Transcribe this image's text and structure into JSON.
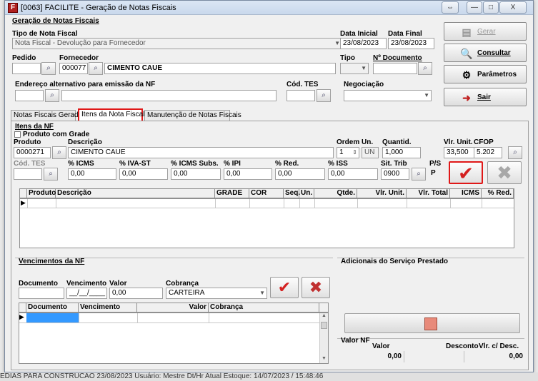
{
  "window": {
    "title": "[0063] FACILITE - Geração de Notas Fiscais",
    "icon_letter": "F",
    "controls": {
      "min": "—",
      "max": "□",
      "close": "X",
      "extra": "⇔"
    }
  },
  "header": {
    "section_title": "Geração de Notas Fiscais",
    "tipo_label": "Tipo de Nota Fiscal",
    "tipo_value": "Nota Fiscal - Devolução para Fornecedor",
    "data_inicial_label": "Data Inicial",
    "data_inicial": "23/08/2023",
    "data_final_label": "Data Final",
    "data_final": "23/08/2023",
    "pedido_label": "Pedido",
    "pedido_value": "",
    "fornecedor_label": "Fornecedor",
    "fornecedor_code": "000077",
    "fornecedor_name": "CIMENTO CAUE",
    "tipo2_label": "Tipo",
    "tipo2_value": "",
    "num_doc_label": "Nº Documento",
    "num_doc_value": "",
    "endereco_label": "Endereço alternativo para emissão da NF",
    "endereco_code": "",
    "endereco_text": "",
    "cod_tes_label": "Cód. TES",
    "cod_tes_value": "",
    "negociacao_label": "Negociação",
    "negociacao_value": ""
  },
  "side_buttons": {
    "gerar": "Gerar",
    "consultar": "Consultar",
    "parametros": "Parâmetros",
    "sair": "Sair"
  },
  "tabs": [
    "Notas Fiscais Geradas",
    "Itens da Nota Fiscal",
    "Manutenção de Notas Fiscais"
  ],
  "itens": {
    "section": "Itens da NF",
    "produto_com_grade": "Produto com Grade",
    "produto_label": "Produto",
    "produto_value": "0000271",
    "descricao_label": "Descrição",
    "descricao_value": "CIMENTO CAUE",
    "ordem_label": "Ordem",
    "ordem_value": "1",
    "un_label": "Un.",
    "un_value": "UN",
    "quantid_label": "Quantid.",
    "quantid_value": "1,000",
    "vlr_unit_label": "Vlr. Unit.",
    "vlr_unit_value": "33,500",
    "cfop_label": "CFOP",
    "cfop_value": "5.202",
    "cod_tes_label": "Cód. TES",
    "cod_tes_value": "",
    "icms_label": "% ICMS",
    "icms_value": "0,00",
    "iva_label": "% IVA-ST",
    "iva_value": "0,00",
    "icms_subs_label": "% ICMS Subs.",
    "icms_subs_value": "0,00",
    "ipi_label": "% IPI",
    "ipi_value": "0,00",
    "red_label": "% Red.",
    "red_value": "0,00",
    "iss_label": "% ISS",
    "iss_value": "0,00",
    "sit_trib_label": "Sit. Trib",
    "sit_trib_value": "0900",
    "ps_label": "P/S",
    "ps_value": "P",
    "grid_headers": [
      "Produto",
      "Descrição",
      "GRADE",
      "COR",
      "Seq.",
      "Un.",
      "Qtde.",
      "Vlr. Unit.",
      "Vlr. Total",
      "ICMS",
      "% Red."
    ]
  },
  "vencimentos": {
    "section": "Vencimentos da NF",
    "documento_label": "Documento",
    "documento_value": "",
    "vencimento_label": "Vencimento",
    "vencimento_value": "__/__/____",
    "valor_label": "Valor",
    "valor_value": "0,00",
    "cobranca_label": "Cobrança",
    "cobranca_value": "CARTEIRA",
    "grid_headers": [
      "Documento",
      "Vencimento",
      "Valor",
      "Cobrança"
    ]
  },
  "adicionais": {
    "section": "Adicionais do Serviço Prestado"
  },
  "totais": {
    "valor_nf_label": "Valor NF",
    "valor_label": "Valor",
    "valor_value": "0,00",
    "desconto_label": "Desconto",
    "desconto_value": "",
    "vlr_desc_label": "Vlr. c/ Desc.",
    "vlr_desc_value": "0,00"
  },
  "status_bar": "EDIAS PARA CONSTRUCAO            23/08/2023   Usuário: Mestre          Dt/Hr Atual Estoque: 14/07/2023 / 15:48:46",
  "colors": {
    "accent_red": "#e01818",
    "check_red": "#d42020",
    "x_gray": "#9a9a9a",
    "delete_red": "#c03030"
  }
}
